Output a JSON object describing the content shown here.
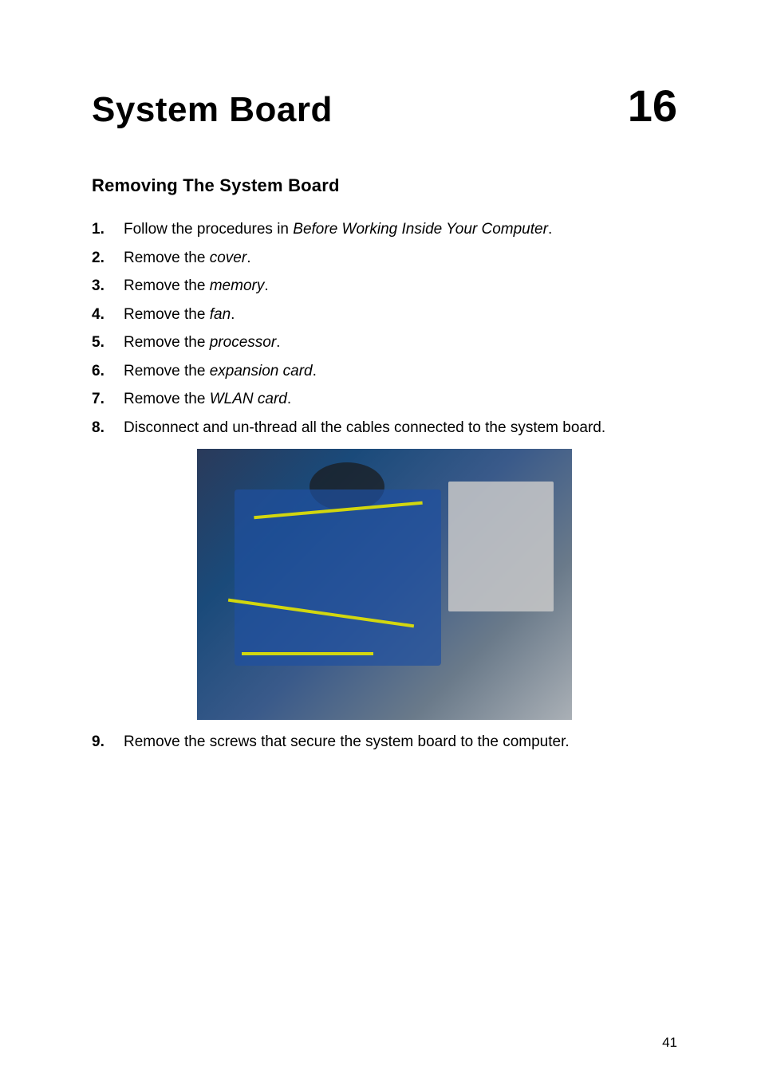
{
  "header": {
    "chapter_title": "System Board",
    "chapter_number": "16"
  },
  "section": {
    "title": "Removing The System Board"
  },
  "steps": [
    {
      "number": "1.",
      "prefix": "Follow the procedures in ",
      "italic": "Before Working Inside Your Computer",
      "suffix": "."
    },
    {
      "number": "2.",
      "prefix": "Remove the ",
      "italic": "cover",
      "suffix": "."
    },
    {
      "number": "3.",
      "prefix": "Remove the ",
      "italic": "memory",
      "suffix": "."
    },
    {
      "number": "4.",
      "prefix": "Remove the ",
      "italic": "fan",
      "suffix": "."
    },
    {
      "number": "5.",
      "prefix": "Remove the ",
      "italic": "processor",
      "suffix": "."
    },
    {
      "number": "6.",
      "prefix": "Remove the ",
      "italic": "expansion card",
      "suffix": "."
    },
    {
      "number": "7.",
      "prefix": "Remove the ",
      "italic": "WLAN card",
      "suffix": "."
    },
    {
      "number": "8.",
      "prefix": "Disconnect and un-thread all the cables connected to the system board.",
      "italic": "",
      "suffix": ""
    },
    {
      "number": "9.",
      "prefix": "Remove the screws that secure the system board to the computer.",
      "italic": "",
      "suffix": ""
    }
  ],
  "page_number": "41"
}
